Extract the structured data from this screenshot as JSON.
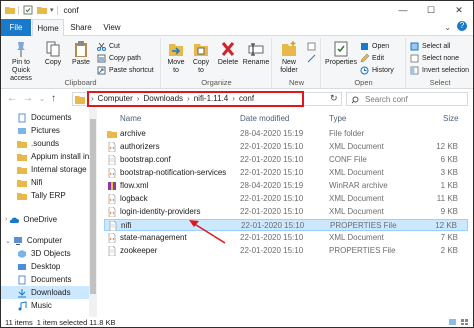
{
  "window": {
    "title": "conf",
    "minimize": "—",
    "maximize": "☐",
    "close": "✕"
  },
  "tabs": {
    "file": "File",
    "home": "Home",
    "share": "Share",
    "view": "View"
  },
  "ribbon": {
    "clipboard": {
      "label": "Clipboard",
      "pin": "Pin to Quick access",
      "copy": "Copy",
      "paste": "Paste",
      "cut": "Cut",
      "copy_path": "Copy path",
      "paste_shortcut": "Paste shortcut"
    },
    "organize": {
      "label": "Organize",
      "move_to": "Move to",
      "copy_to": "Copy to",
      "delete": "Delete",
      "rename": "Rename"
    },
    "new": {
      "label": "New",
      "new_folder": "New folder"
    },
    "open": {
      "label": "Open",
      "properties": "Properties",
      "open": "Open",
      "edit": "Edit",
      "history": "History"
    },
    "select": {
      "label": "Select",
      "select_all": "Select all",
      "select_none": "Select none",
      "invert_selection": "Invert selection"
    }
  },
  "address": {
    "crumbs": [
      "Computer",
      "Downloads",
      "nifi-1.11.4",
      "conf"
    ],
    "search_placeholder": "Search conf"
  },
  "nav": {
    "items": [
      {
        "label": "Documents"
      },
      {
        "label": "Pictures"
      },
      {
        "label": ".sounds"
      },
      {
        "label": "Appium install in"
      },
      {
        "label": "Internal storage"
      },
      {
        "label": "Nifi"
      },
      {
        "label": "Tally ERP"
      },
      {
        "label": "OneDrive"
      },
      {
        "label": "Computer"
      },
      {
        "label": "3D Objects"
      },
      {
        "label": "Desktop"
      },
      {
        "label": "Documents"
      },
      {
        "label": "Downloads"
      },
      {
        "label": "Music"
      }
    ]
  },
  "columns": {
    "name": "Name",
    "date": "Date modified",
    "type": "Type",
    "size": "Size"
  },
  "files": [
    {
      "name": "archive",
      "date": "28-04-2020 15:19",
      "type": "File folder",
      "size": "",
      "icon": "folder-icon"
    },
    {
      "name": "authorizers",
      "date": "22-01-2020 15:10",
      "type": "XML Document",
      "size": "12 KB",
      "icon": "xml-file-icon"
    },
    {
      "name": "bootstrap.conf",
      "date": "22-01-2020 15:10",
      "type": "CONF File",
      "size": "6 KB",
      "icon": "file-icon"
    },
    {
      "name": "bootstrap-notification-services",
      "date": "22-01-2020 15:10",
      "type": "XML Document",
      "size": "3 KB",
      "icon": "xml-file-icon"
    },
    {
      "name": "flow.xml",
      "date": "28-04-2020 15:19",
      "type": "WinRAR archive",
      "size": "1 KB",
      "icon": "archive-icon"
    },
    {
      "name": "logback",
      "date": "22-01-2020 15:10",
      "type": "XML Document",
      "size": "11 KB",
      "icon": "xml-file-icon"
    },
    {
      "name": "login-identity-providers",
      "date": "22-01-2020 15:10",
      "type": "XML Document",
      "size": "9 KB",
      "icon": "xml-file-icon"
    },
    {
      "name": "nifi",
      "date": "22-01-2020 15:10",
      "type": "PROPERTIES File",
      "size": "12 KB",
      "icon": "file-icon"
    },
    {
      "name": "state-management",
      "date": "22-01-2020 15:10",
      "type": "XML Document",
      "size": "7 KB",
      "icon": "xml-file-icon"
    },
    {
      "name": "zookeeper",
      "date": "22-01-2020 15:10",
      "type": "PROPERTIES File",
      "size": "2 KB",
      "icon": "file-icon"
    }
  ],
  "status": {
    "items": "11 items",
    "selected": "1 item selected  11.8 KB"
  },
  "colors": {
    "accent": "#1979ca",
    "highlight": "#e0161b",
    "selection": "#cce8ff"
  }
}
